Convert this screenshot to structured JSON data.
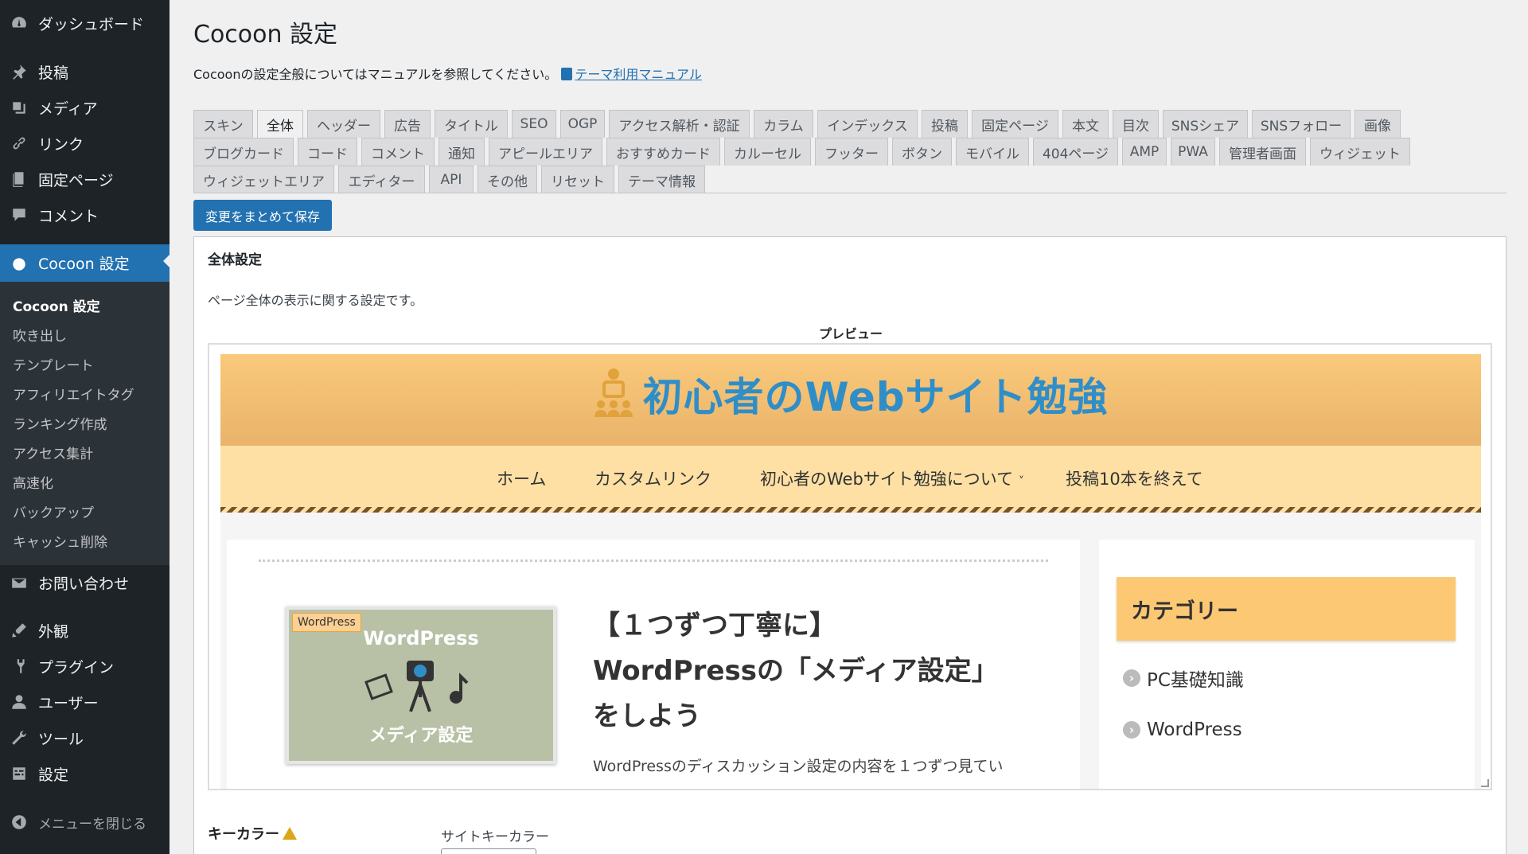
{
  "sidebar": {
    "menu": [
      {
        "label": "ダッシュボード",
        "icon": "dashboard-icon"
      },
      {
        "label": "投稿",
        "icon": "pin-icon"
      },
      {
        "label": "メディア",
        "icon": "media-icon"
      },
      {
        "label": "リンク",
        "icon": "link-icon"
      },
      {
        "label": "固定ページ",
        "icon": "page-icon"
      },
      {
        "label": "コメント",
        "icon": "comment-icon"
      },
      {
        "label": "Cocoon 設定",
        "icon": "cocoon-icon"
      },
      {
        "label": "お問い合わせ",
        "icon": "mail-icon"
      },
      {
        "label": "外観",
        "icon": "appearance-icon"
      },
      {
        "label": "プラグイン",
        "icon": "plugin-icon"
      },
      {
        "label": "ユーザー",
        "icon": "user-icon"
      },
      {
        "label": "ツール",
        "icon": "tool-icon"
      },
      {
        "label": "設定",
        "icon": "settings-icon"
      },
      {
        "label": "メニューを閉じる",
        "icon": "collapse-icon"
      }
    ],
    "submenu": [
      "Cocoon 設定",
      "吹き出し",
      "テンプレート",
      "アフィリエイトタグ",
      "ランキング作成",
      "アクセス集計",
      "高速化",
      "バックアップ",
      "キャッシュ削除"
    ]
  },
  "page": {
    "title": "Cocoon 設定",
    "intro": "Cocoonの設定全般についてはマニュアルを参照してください。",
    "manual_link": "テーマ利用マニュアル",
    "save_label": "変更をまとめて保存"
  },
  "tabs": [
    [
      "スキン",
      "全体",
      "ヘッダー",
      "広告",
      "タイトル",
      "SEO",
      "OGP",
      "アクセス解析・認証",
      "カラム",
      "インデックス",
      "投稿",
      "固定ページ",
      "本文",
      "目次",
      "SNSシェア",
      "SNSフォロー",
      "画像"
    ],
    [
      "ブログカード",
      "コード",
      "コメント",
      "通知",
      "アピールエリア",
      "おすすめカード",
      "カルーセル",
      "フッター",
      "ボタン",
      "モバイル",
      "404ページ",
      "AMP",
      "PWA",
      "管理者画面",
      "ウィジェット"
    ],
    [
      "ウィジェットエリア",
      "エディター",
      "API",
      "その他",
      "リセット",
      "テーマ情報"
    ]
  ],
  "active_tab": "全体",
  "panel": {
    "heading": "全体設定",
    "description": "ページ全体の表示に関する設定です。",
    "preview_label": "プレビュー",
    "key_color_label": "キーカラー",
    "site_key_color_label": "サイトキーカラー"
  },
  "preview": {
    "site_title": "初心者のWebサイト勉強",
    "nav": [
      "ホーム",
      "カスタムリンク",
      "初心者のWebサイト勉強について",
      "投稿10本を終えて"
    ],
    "nav_dropdown_symbol": "˅",
    "article": {
      "category_tag": "WordPress",
      "thumb_title": "WordPress",
      "thumb_subtitle": "メディア設定",
      "title_lines": [
        "【１つずつ丁寧に】",
        "WordPressの「メディア設定」",
        "をしよう"
      ],
      "excerpt": "WordPressのディスカッション設定の内容を１つずつ見てい"
    },
    "widget": {
      "heading": "カテゴリー",
      "items": [
        "PC基礎知識",
        "WordPress"
      ]
    }
  },
  "colors": {
    "sidebar_bg": "#1d2327",
    "accent": "#2271b1",
    "header_orange": "#fac97a",
    "site_title_blue": "#2f8ec8"
  }
}
